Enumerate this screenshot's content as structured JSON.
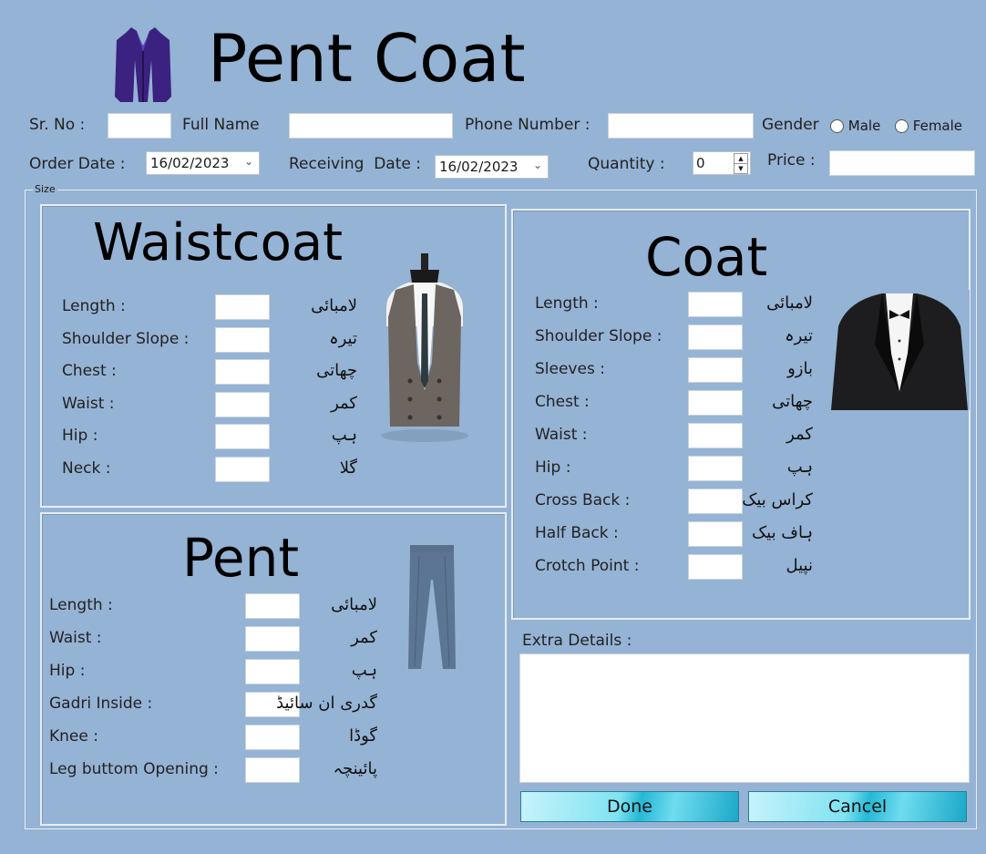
{
  "header": {
    "title": "Pent Coat",
    "icon": "jacket-icon"
  },
  "form": {
    "sr_no_label": "Sr. No :",
    "full_name_label": "Full Name",
    "phone_label": "Phone Number :",
    "gender_label": "Gender",
    "male_label": "Male",
    "female_label": "Female",
    "order_date_label": "Order Date :",
    "order_date_value": "16/02/2023",
    "receiving_date_label": "Receiving  Date :",
    "receiving_date_value": "16/02/2023",
    "quantity_label": "Quantity :",
    "quantity_value": "0",
    "price_label": "Price :"
  },
  "size_group_label": "Size",
  "waistcoat": {
    "title": "Waistcoat",
    "image": "waistcoat-mannequin-image",
    "fields": [
      {
        "label": "Length :",
        "urdu": "لامبائی"
      },
      {
        "label": "Shoulder Slope :",
        "urdu": "تیرہ"
      },
      {
        "label": "Chest :",
        "urdu": "چھاتی"
      },
      {
        "label": "Waist :",
        "urdu": "کمر"
      },
      {
        "label": "Hip :",
        "urdu": "ہپ"
      },
      {
        "label": "Neck :",
        "urdu": "گلا"
      }
    ]
  },
  "pent": {
    "title": "Pent",
    "image": "trousers-image",
    "fields": [
      {
        "label": "Length :",
        "urdu": "لامبائی"
      },
      {
        "label": "Waist :",
        "urdu": "کمر"
      },
      {
        "label": "Hip :",
        "urdu": "ہپ"
      },
      {
        "label": "Gadri Inside :",
        "urdu": "گدری ان سائیڈ"
      },
      {
        "label": "Knee :",
        "urdu": "گوڈا"
      },
      {
        "label": "Leg buttom Opening :",
        "urdu": "پائینچہ"
      }
    ]
  },
  "coat": {
    "title": "Coat",
    "image": "tuxedo-image",
    "fields": [
      {
        "label": "Length :",
        "urdu": "لامبائی"
      },
      {
        "label": "Shoulder Slope :",
        "urdu": "تیرہ"
      },
      {
        "label": "Sleeves :",
        "urdu": "بازو"
      },
      {
        "label": "Chest :",
        "urdu": "چھاتی"
      },
      {
        "label": "Waist :",
        "urdu": "کمر"
      },
      {
        "label": "Hip :",
        "urdu": "ہپ"
      },
      {
        "label": "Cross Back :",
        "urdu": "کراس بیک"
      },
      {
        "label": "Half Back :",
        "urdu": "ہاف بیک"
      },
      {
        "label": "Crotch Point :",
        "urdu": "نپیل"
      }
    ]
  },
  "extra_details_label": "Extra Details :",
  "buttons": {
    "done": "Done",
    "cancel": "Cancel"
  }
}
